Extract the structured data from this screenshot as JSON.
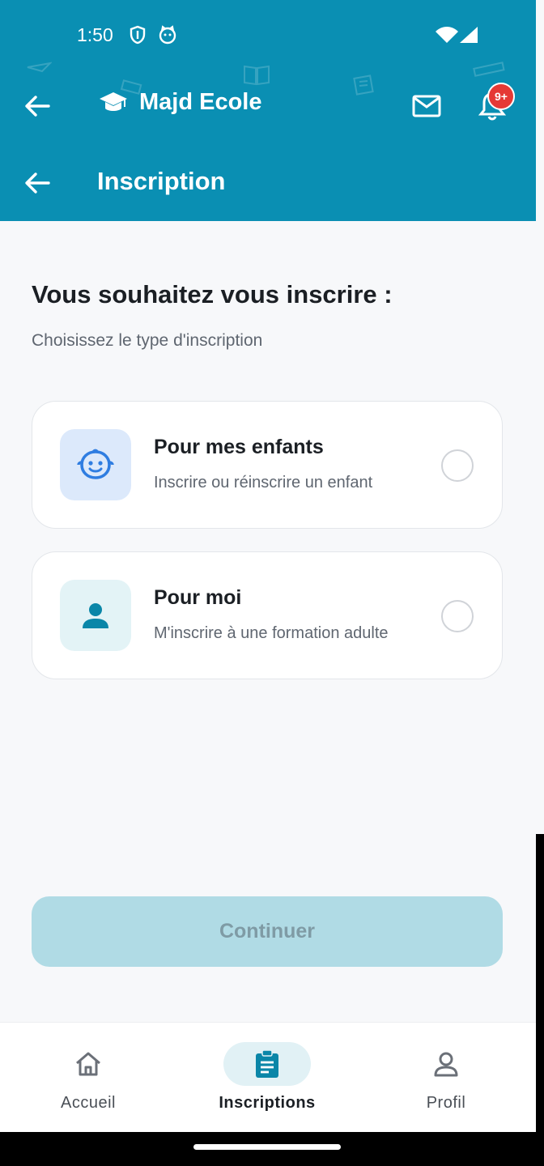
{
  "status_bar": {
    "time": "1:50",
    "icons": [
      "shield-icon",
      "cat-icon",
      "wifi-icon",
      "cell-signal-icon"
    ]
  },
  "app_bar": {
    "brand_icon": "graduation-cap-icon",
    "brand_name": "Majd Ecole",
    "notification_badge": "9+"
  },
  "page": {
    "title": "Inscription",
    "heading": "Vous souhaitez vous inscrire :",
    "subheading": "Choisissez le type d'inscription"
  },
  "options": [
    {
      "icon": "baby-face-icon",
      "title": "Pour mes enfants",
      "subtitle": "Inscrire ou réinscrire un enfant",
      "selected": false
    },
    {
      "icon": "person-icon",
      "title": "Pour moi",
      "subtitle": "M'inscrire à une formation adulte",
      "selected": false
    }
  ],
  "continue_button": {
    "label": "Continuer",
    "enabled": false
  },
  "bottom_nav": [
    {
      "label": "Accueil",
      "icon": "home-icon",
      "active": false
    },
    {
      "label": "Inscriptions",
      "icon": "clipboard-icon",
      "active": true
    },
    {
      "label": "Profil",
      "icon": "person-outline-icon",
      "active": false
    }
  ],
  "colors": {
    "primary": "#0a8fb3",
    "badge": "#e53935",
    "disabled_button": "#b0dbe5",
    "child_icon_bg": "#dce9fb",
    "adult_icon_bg": "#e3f3f6",
    "active_nav_bg": "#e1f1f5"
  }
}
